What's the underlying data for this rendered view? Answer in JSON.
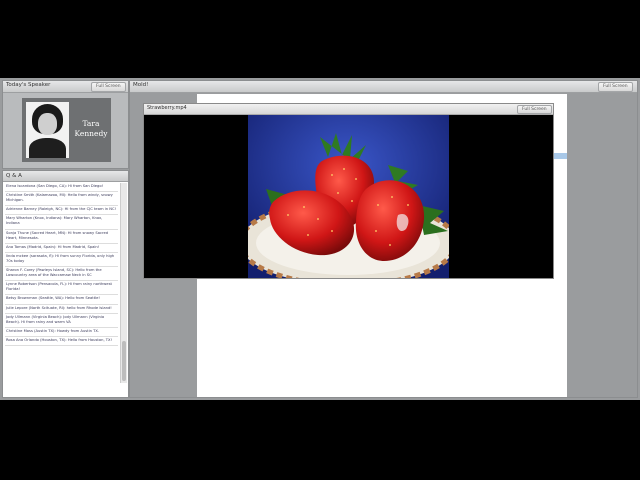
{
  "speaker_panel": {
    "title": "Today's Speaker",
    "full_screen_label": "Full Screen",
    "name_line1": "Tara",
    "name_line2": "Kennedy"
  },
  "qa": {
    "title": "Q & A",
    "items": [
      "Elena Iscardona (San Diego, CA): Hi from San Diego!",
      "Christine Smith (Kalamazoo, MI): Hello from windy, snowy Michigan.",
      "Adrienne Barney (Raleigh, NC): Hi from the CJC team in NC!",
      "Mary Wharton (Knox, Indiana): Mary Wharton, Knox, Indiana",
      "Sonja Thune (Sacred Heart, MN): Hi from snowy Sacred Heart, Minnesota.",
      "Ana Tomas (Madrid, Spain): Hi from Madrid, Spain!",
      "linda mckee (sarasota, fl): Hi from sunny Florida, only high 70s today",
      "Sharon F. Corey (Pawleys Island, SC): Hello from the Lowcountry area of the Waccamaw Neck in SC",
      "Lynne Robertson (Pensacola, FL): Hi from rainy northwest Florida!",
      "Betsy Brownman (Seattle, WA): Hello from Seattle!",
      "Julie Lepore (North Scituate, RI): hello from Rhode Island!",
      "Jody Ullmann (Virginia Beach): Jody Ullmann (Virginia Beach). Hi from rainy and warm VA",
      "Christine Moss (Austin TX): Howdy from Austin TX.",
      "Rosa Ana Orlando (Houston, TX): Hello from Houston, TX!"
    ]
  },
  "main": {
    "title": "Mold!",
    "full_screen_label": "Full Screen"
  },
  "video": {
    "title": "Strawberry.mp4",
    "full_screen_label": "Full Screen"
  },
  "colors": {
    "backdrop": "#000000",
    "chrome": "#9a9c9e",
    "bar_top": "#e6e7e8",
    "bar_bottom": "#c9cacb",
    "strawberry": "#d81c1c",
    "video_bg": "#1a2a8a"
  }
}
